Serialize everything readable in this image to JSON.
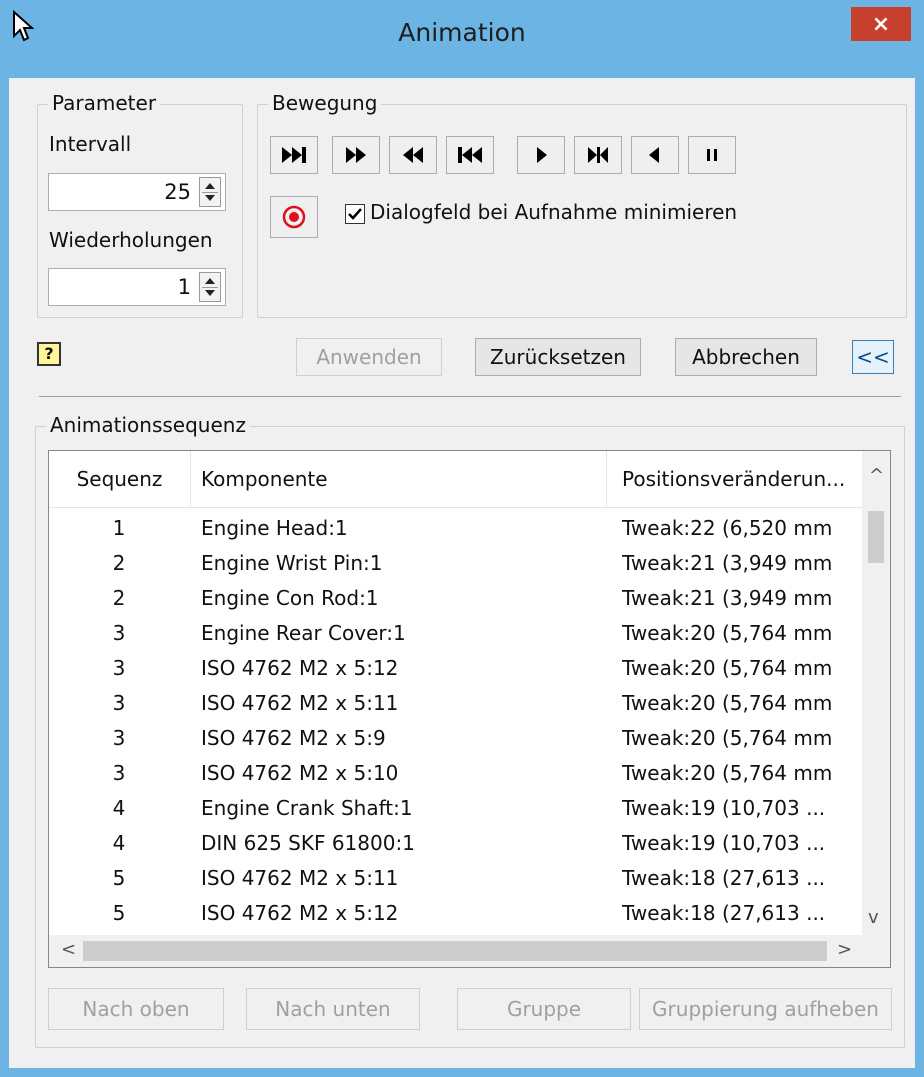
{
  "window": {
    "title": "Animation",
    "close_label": "×"
  },
  "parameter": {
    "legend": "Parameter",
    "interval_label": "Intervall",
    "interval_value": "25",
    "repeats_label": "Wiederholungen",
    "repeats_value": "1"
  },
  "movement": {
    "legend": "Bewegung",
    "buttons": [
      "to-end",
      "step-forward",
      "step-backward",
      "to-start",
      "play-forward",
      "play-to-end",
      "play-backward",
      "pause"
    ],
    "minimize_checkbox_label": "Dialogfeld bei Aufnahme minimieren",
    "minimize_checked": true
  },
  "actions": {
    "apply": "Anwenden",
    "reset": "Zurücksetzen",
    "cancel": "Abbrechen",
    "collapse": "<<"
  },
  "sequence": {
    "legend": "Animationssequenz",
    "columns": [
      "Sequenz",
      "Komponente",
      "Positionsveränderun..."
    ],
    "rows": [
      [
        "1",
        "Engine Head:1",
        "Tweak:22 (6,520 mm"
      ],
      [
        "2",
        "Engine Wrist Pin:1",
        "Tweak:21 (3,949 mm"
      ],
      [
        "2",
        "Engine Con Rod:1",
        "Tweak:21 (3,949 mm"
      ],
      [
        "3",
        "Engine Rear Cover:1",
        "Tweak:20 (5,764 mm"
      ],
      [
        "3",
        "ISO 4762 M2 x 5:12",
        "Tweak:20 (5,764 mm"
      ],
      [
        "3",
        "ISO 4762 M2 x 5:11",
        "Tweak:20 (5,764 mm"
      ],
      [
        "3",
        "ISO 4762 M2 x 5:9",
        "Tweak:20 (5,764 mm"
      ],
      [
        "3",
        "ISO 4762 M2 x 5:10",
        "Tweak:20 (5,764 mm"
      ],
      [
        "4",
        "Engine Crank Shaft:1",
        "Tweak:19 (10,703 ..."
      ],
      [
        "4",
        "DIN 625 SKF 61800:1",
        "Tweak:19 (10,703 ..."
      ],
      [
        "5",
        "ISO 4762 M2 x 5:11",
        "Tweak:18 (27,613 ..."
      ],
      [
        "5",
        "ISO 4762 M2 x 5:12",
        "Tweak:18 (27,613 ..."
      ]
    ]
  },
  "bottom": {
    "move_up": "Nach oben",
    "move_down": "Nach unten",
    "group": "Gruppe",
    "ungroup": "Gruppierung aufheben"
  }
}
